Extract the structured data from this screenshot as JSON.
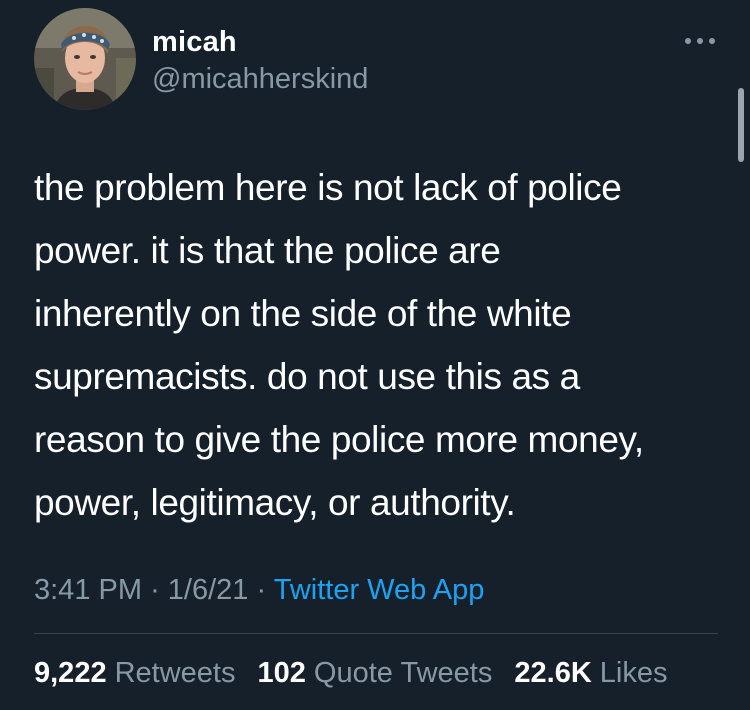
{
  "theme": {
    "background": "#15202b",
    "text_primary": "#ffffff",
    "text_secondary": "#8899a6",
    "link": "#1da1f2",
    "divider": "#38444d"
  },
  "author": {
    "display_name": "micah",
    "handle": "@micahherskind",
    "avatar_icon": "user-avatar"
  },
  "menu": {
    "icon": "more-horizontal-icon"
  },
  "tweet": {
    "lines": [
      "the problem here is not lack of police",
      "power. it is that the police are",
      "inherently on the side of the white",
      "supremacists. do not use this as a",
      "reason to give the police more money,",
      "power, legitimacy, or authority."
    ]
  },
  "meta": {
    "time": "3:41 PM",
    "date": "1/6/21",
    "separator": "·",
    "source": "Twitter Web App"
  },
  "stats": {
    "retweets_count": "9,222",
    "retweets_label": "Retweets",
    "quotes_count": "102",
    "quotes_label": "Quote Tweets",
    "likes_count": "22.6K",
    "likes_label": "Likes"
  }
}
